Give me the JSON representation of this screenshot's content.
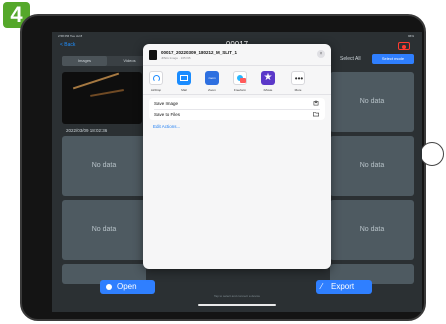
{
  "badge": {
    "step": "4"
  },
  "status_bar": {
    "left": "2:58 PM  Tue Jul 8",
    "right": "96%"
  },
  "nav": {
    "back_label": "< Back",
    "title": "00017"
  },
  "segment": {
    "items": [
      "Images",
      "Videos"
    ],
    "active_index": 0
  },
  "toolbar": {
    "select_all_label": "Select All",
    "select_mode_label": "Select mode"
  },
  "grid": {
    "no_data_label": "No data",
    "first_timestamp": "2022/03/09 18:02:36"
  },
  "share_sheet": {
    "file_name": "00017_20220309_180212_M_SLIT_1",
    "file_info": "JPEG Image · 165 KB",
    "close_glyph": "×",
    "apps": [
      {
        "label": "AirDrop",
        "icon": "airdrop-icon"
      },
      {
        "label": "Mail",
        "icon": "mail-icon"
      },
      {
        "label": "Zoom",
        "icon": "zoom-icon"
      },
      {
        "label": "Freeform",
        "icon": "freeform-icon"
      },
      {
        "label": "iMovie",
        "icon": "imovie-icon"
      },
      {
        "label": "More",
        "icon": "more-icon"
      }
    ],
    "zoom_text": "zoom",
    "actions": [
      {
        "label": "Save Image",
        "icon": "save-image-icon"
      },
      {
        "label": "Save to Files",
        "icon": "folder-icon"
      }
    ],
    "edit_actions_label": "Edit Actions..."
  },
  "bottom_bar": {
    "open_label": "Open",
    "export_label": "Export",
    "hint_text": "Tap to select and connect a device"
  },
  "colors": {
    "accent": "#2f7fff",
    "badge": "#55a82a",
    "background": "#2b3033",
    "cell": "#4e5a61"
  }
}
